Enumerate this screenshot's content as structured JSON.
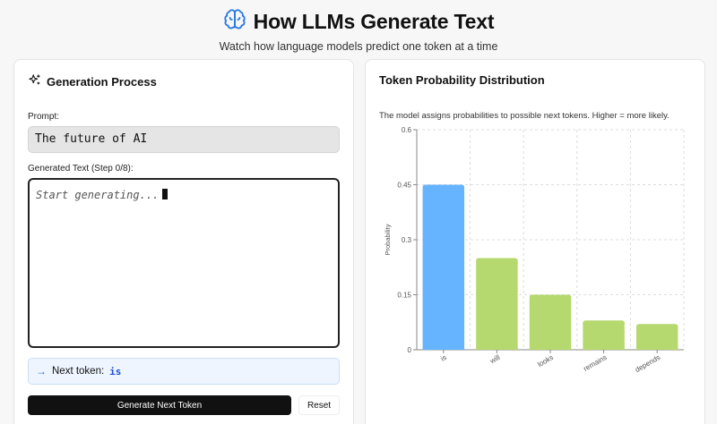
{
  "header": {
    "title": "How LLMs Generate Text",
    "subtitle": "Watch how language models predict one token at a time",
    "icon": "brain-icon"
  },
  "left_panel": {
    "title": "Generation Process",
    "icon": "sparkles-icon",
    "prompt_label": "Prompt:",
    "prompt_value": "The future of AI",
    "generated_label": "Generated Text (Step 0/8):",
    "generated_placeholder": "Start generating...",
    "next_token_label": "Next token:",
    "next_token_value": "is",
    "generate_button": "Generate Next Token",
    "reset_button": "Reset"
  },
  "right_panel": {
    "title": "Token Probability Distribution",
    "description": "The model assigns probabilities to possible next tokens. Higher = more likely."
  },
  "colors": {
    "highlight_bar": "#66b3ff",
    "other_bar": "#b5d96e",
    "accent": "#1d4ed8"
  },
  "chart_data": {
    "type": "bar",
    "categories": [
      "is",
      "will",
      "looks",
      "remains",
      "depends"
    ],
    "values": [
      0.45,
      0.25,
      0.15,
      0.08,
      0.07
    ],
    "highlight_index": 0,
    "ylabel": "Probability",
    "xlabel": "",
    "ylim": [
      0,
      0.6
    ],
    "yticks": [
      "0",
      "0.15",
      "0.3",
      "0.45",
      "0.6"
    ],
    "grid": true
  }
}
